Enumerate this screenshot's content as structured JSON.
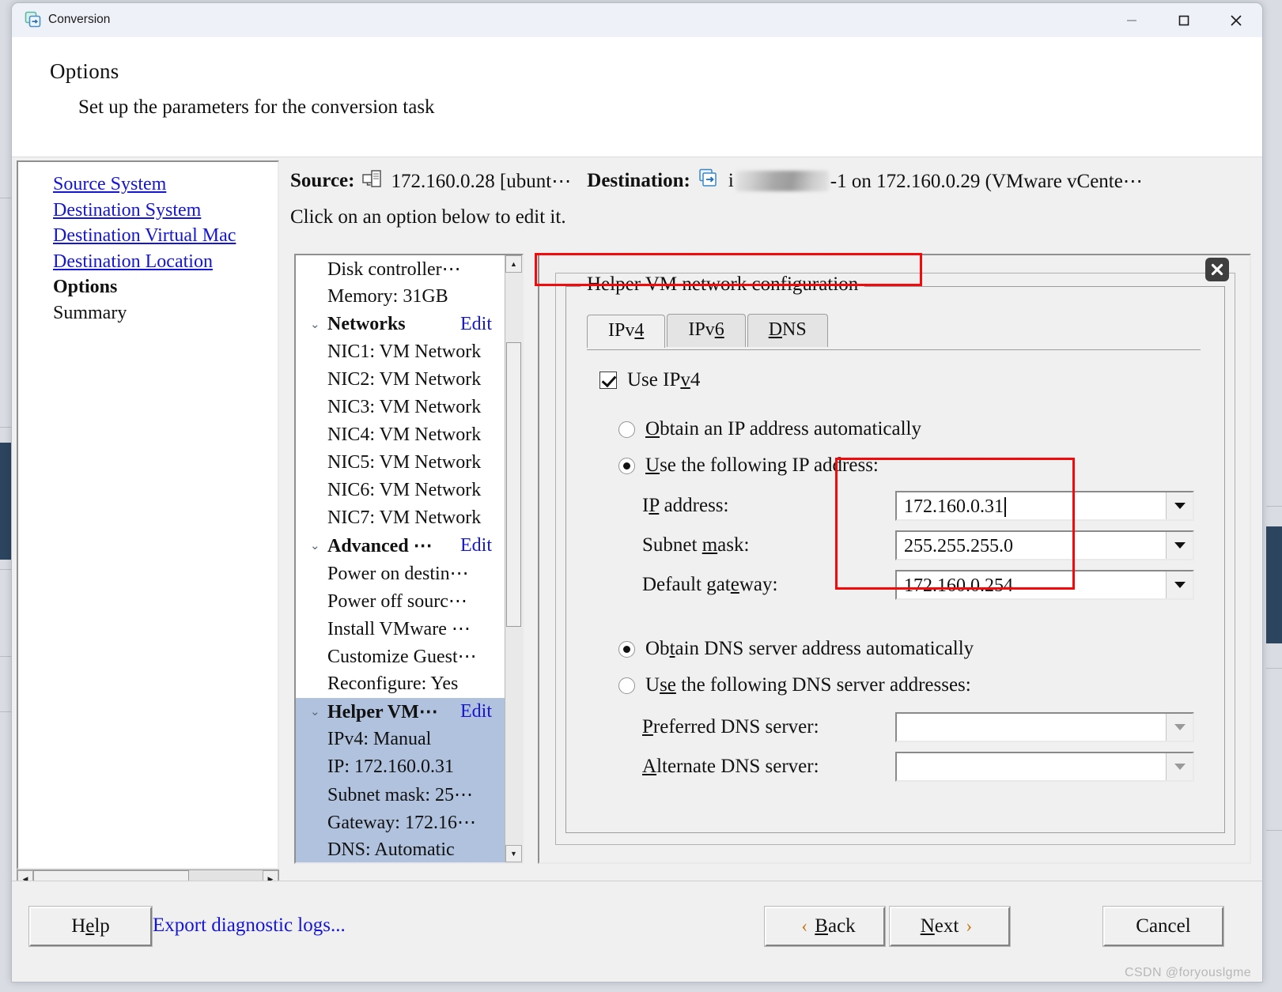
{
  "window": {
    "title": "Conversion",
    "icon": "conversion-app-icon",
    "controls": {
      "minimize": "minimize-icon",
      "maximize": "maximize-icon",
      "close": "close-icon"
    }
  },
  "header": {
    "title": "Options",
    "subtitle": "Set up the parameters for the conversion task"
  },
  "nav": {
    "items": [
      {
        "label": "Source System",
        "state": "link"
      },
      {
        "label": "Destination System",
        "state": "link"
      },
      {
        "label": "Destination Virtual Mac",
        "state": "link"
      },
      {
        "label": "Destination Location",
        "state": "link"
      },
      {
        "label": "Options",
        "state": "current"
      },
      {
        "label": "Summary",
        "state": "plain"
      }
    ]
  },
  "context": {
    "source_label": "Source:",
    "source_icon": "computer-icon",
    "source_value": "172.160.0.28 [ubunt⋯",
    "destination_label": "Destination:",
    "destination_icon": "vm-transfer-icon",
    "destination_prefix": "i",
    "destination_value": "⁠-1 on 172.160.0.29 (VMware vCente⋯",
    "hint": "Click on an option below to edit it."
  },
  "tree": {
    "rows": [
      {
        "label": "Disk controller⋯",
        "type": "child",
        "selected": false
      },
      {
        "label": "Memory: 31GB",
        "type": "child",
        "selected": false
      },
      {
        "label": "Networks",
        "type": "group",
        "edit": "Edit",
        "selected": false
      },
      {
        "label": "NIC1: VM Network",
        "type": "child",
        "selected": false
      },
      {
        "label": "NIC2: VM Network",
        "type": "child",
        "selected": false
      },
      {
        "label": "NIC3: VM Network",
        "type": "child",
        "selected": false
      },
      {
        "label": "NIC4: VM Network",
        "type": "child",
        "selected": false
      },
      {
        "label": "NIC5: VM Network",
        "type": "child",
        "selected": false
      },
      {
        "label": "NIC6: VM Network",
        "type": "child",
        "selected": false
      },
      {
        "label": "NIC7: VM Network",
        "type": "child",
        "selected": false
      },
      {
        "label": "Advanced ⋯",
        "type": "group",
        "edit": "Edit",
        "selected": false
      },
      {
        "label": "Power on destin⋯",
        "type": "child",
        "selected": false
      },
      {
        "label": "Power off sourc⋯",
        "type": "child",
        "selected": false
      },
      {
        "label": "Install VMware ⋯",
        "type": "child",
        "selected": false
      },
      {
        "label": "Customize Guest⋯",
        "type": "child",
        "selected": false
      },
      {
        "label": "Reconfigure: Yes",
        "type": "child",
        "selected": false
      },
      {
        "label": "Helper VM⋯",
        "type": "group",
        "edit": "Edit",
        "selected": true
      },
      {
        "label": "IPv4: Manual",
        "type": "child",
        "selected": true
      },
      {
        "label": "IP: 172.160.0.31",
        "type": "child",
        "selected": true
      },
      {
        "label": "Subnet mask: 25⋯",
        "type": "child",
        "selected": true
      },
      {
        "label": "Gateway: 172.16⋯",
        "type": "child",
        "selected": true
      },
      {
        "label": "DNS: Automatic",
        "type": "child",
        "selected": true
      }
    ]
  },
  "config": {
    "group_title": "Helper VM network configuration",
    "close_icon": "dialog-close-icon",
    "tabs": [
      {
        "id": "ipv4",
        "pre": "IPv",
        "mnemonic": "4",
        "post": "",
        "active": true
      },
      {
        "id": "ipv6",
        "pre": "IPv",
        "mnemonic": "6",
        "post": "",
        "active": false
      },
      {
        "id": "dns",
        "pre": "",
        "mnemonic": "D",
        "post": "NS",
        "active": false
      }
    ],
    "use_ipv4": {
      "label_pre": "Use IP",
      "mnemonic": "v",
      "label_post": "4",
      "checked": true
    },
    "ip_mode": {
      "auto": {
        "pre": "",
        "mnemonic": "O",
        "post": "btain an IP address automatically",
        "selected": false
      },
      "manual": {
        "pre": "",
        "mnemonic": "U",
        "post": "se the following IP address:",
        "selected": true
      }
    },
    "fields": [
      {
        "id": "ip-address",
        "pre": "I",
        "mnemonic": "P",
        "post": " address:",
        "value": "172.160.0.31",
        "cursor": true,
        "enabled": true
      },
      {
        "id": "subnet-mask",
        "pre": "Subnet ",
        "mnemonic": "m",
        "post": "ask:",
        "value": "255.255.255.0",
        "cursor": false,
        "enabled": true
      },
      {
        "id": "default-gateway",
        "pre": "Default gat",
        "mnemonic": "e",
        "post": "way:",
        "value": "172.160.0.254",
        "cursor": false,
        "enabled": true
      }
    ],
    "dns_mode": {
      "auto": {
        "pre": "Ob",
        "mnemonic": "t",
        "post": "ain DNS server address automatically",
        "selected": true
      },
      "manual": {
        "pre": "U",
        "mnemonic": "se",
        "post": " the following DNS server addresses:",
        "selected": false
      }
    },
    "dns_fields": [
      {
        "id": "preferred-dns",
        "pre": "",
        "mnemonic": "P",
        "post": "referred DNS server:",
        "value": "",
        "enabled": false
      },
      {
        "id": "alternate-dns",
        "pre": "",
        "mnemonic": "A",
        "post": "lternate DNS server:",
        "value": "",
        "enabled": false
      }
    ]
  },
  "footer": {
    "help": {
      "pre": "H",
      "mnemonic": "e",
      "post": "lp"
    },
    "export_logs": "Export diagnostic logs...",
    "back": {
      "chev": "‹",
      "pre": "",
      "mnemonic": "B",
      "post": "ack"
    },
    "next": {
      "chev": "›",
      "pre": "",
      "mnemonic": "N",
      "post": "ext"
    },
    "cancel": "Cancel",
    "watermark": "CSDN @foryouslgme"
  },
  "colors": {
    "link": "#1515d6",
    "highlight_red": "#f40a0a",
    "selection_blue": "#b0c2dd",
    "chevron_amber": "#c57d18",
    "window_bg": "#f0f0f0"
  }
}
